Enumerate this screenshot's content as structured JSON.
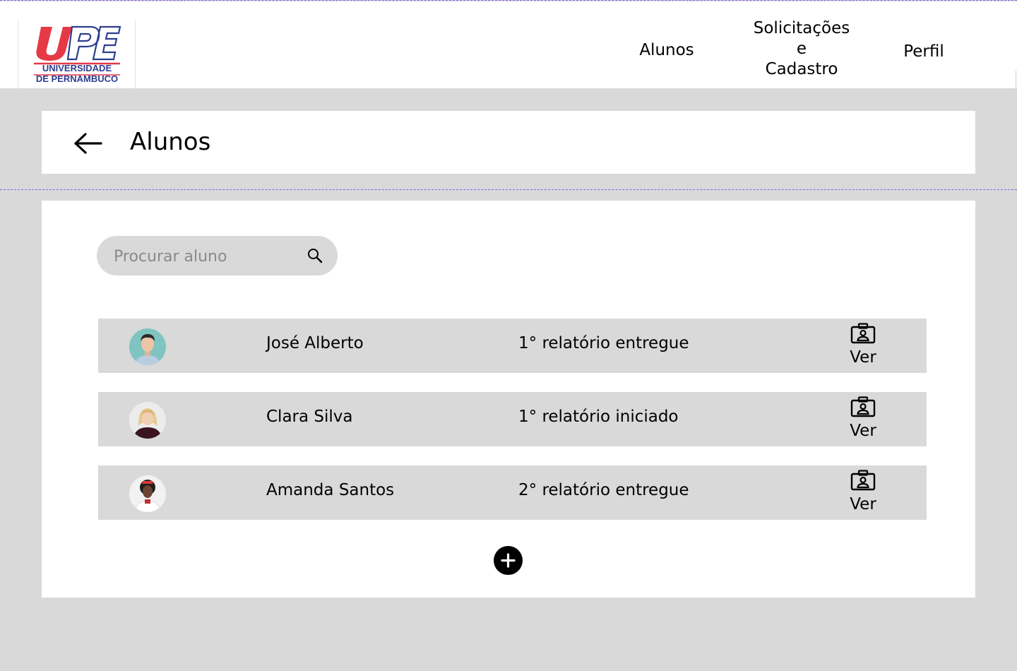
{
  "nav": {
    "logo": {
      "mark": "UPE",
      "line1": "UNIVERSIDADE",
      "line2": "DE PERNAMBUCO"
    },
    "links": [
      {
        "label": "Alunos"
      },
      {
        "label": "Solicitações\ne\nCadastro"
      },
      {
        "label": "Perfil"
      }
    ]
  },
  "header": {
    "title": "Alunos",
    "back_icon": "arrow-left-icon"
  },
  "search": {
    "placeholder": "Procurar aluno",
    "value": "",
    "icon": "search-icon"
  },
  "students": [
    {
      "name": "José Alberto",
      "status": "1° relatório entregue",
      "action_label": "Ver",
      "action_icon": "id-badge-icon"
    },
    {
      "name": "Clara Silva",
      "status": "1° relatório iniciado",
      "action_label": "Ver",
      "action_icon": "id-badge-icon"
    },
    {
      "name": "Amanda Santos",
      "status": "2° relatório entregue",
      "action_label": "Ver",
      "action_icon": "id-badge-icon"
    }
  ],
  "add_button": {
    "icon": "plus-icon"
  },
  "colors": {
    "page_background": "#d9d9d9",
    "card_background": "#ffffff",
    "row_background": "#d9d9d9",
    "logo_red": "#e63946",
    "logo_navy": "#2c3e8f",
    "guide_dash": "#8b5cf6"
  }
}
